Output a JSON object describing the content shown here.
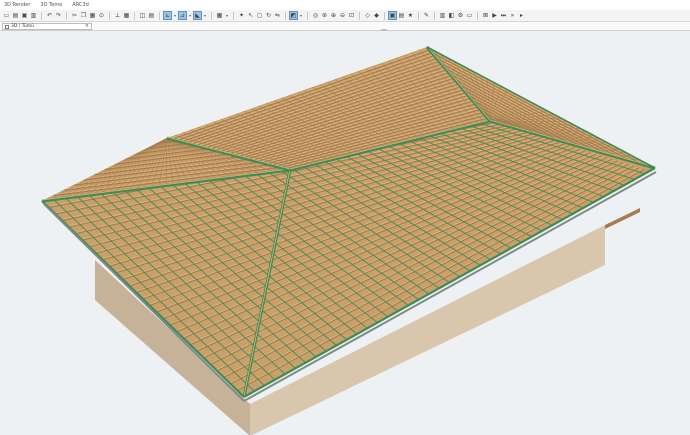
{
  "app": {
    "title_items": [
      "3D Render",
      "3D Teme",
      "ARC3d"
    ]
  },
  "toolbar": {
    "buttons": [
      {
        "name": "new-file-icon",
        "glyph": "▭"
      },
      {
        "name": "open-file-icon",
        "glyph": "▤"
      },
      {
        "name": "save-icon",
        "glyph": "▣"
      },
      {
        "name": "print-icon",
        "glyph": "▥"
      },
      {
        "name": "sep",
        "glyph": ""
      },
      {
        "name": "undo-icon",
        "glyph": "↶"
      },
      {
        "name": "redo-icon",
        "glyph": "↷"
      },
      {
        "name": "sep",
        "glyph": ""
      },
      {
        "name": "cut-icon",
        "glyph": "✂"
      },
      {
        "name": "copy-icon",
        "glyph": "❐"
      },
      {
        "name": "paste-icon",
        "glyph": "▦"
      },
      {
        "name": "pick-icon",
        "glyph": "⊙"
      },
      {
        "name": "sep",
        "glyph": ""
      },
      {
        "name": "measure-icon",
        "glyph": "⟂"
      },
      {
        "name": "grid-icon",
        "glyph": "▦"
      },
      {
        "name": "sep",
        "glyph": ""
      },
      {
        "name": "trace-icon",
        "glyph": "◫"
      },
      {
        "name": "layer-icon",
        "glyph": "▤"
      },
      {
        "name": "sep",
        "glyph": ""
      },
      {
        "name": "snap-icon",
        "glyph": "⊾",
        "active": true
      },
      {
        "name": "dropdown-icon",
        "glyph": "▾",
        "dd": true
      },
      {
        "name": "guide-icon",
        "glyph": "⊿",
        "active": true
      },
      {
        "name": "dropdown-icon",
        "glyph": "▾",
        "dd": true
      },
      {
        "name": "gravity-icon",
        "glyph": "◣",
        "active": true
      },
      {
        "name": "dropdown-icon",
        "glyph": "▾",
        "dd": true
      },
      {
        "name": "sep",
        "glyph": ""
      },
      {
        "name": "suspend-groups-icon",
        "glyph": "▦"
      },
      {
        "name": "dropdown-icon",
        "glyph": "▾",
        "dd": true
      },
      {
        "name": "sep",
        "glyph": ""
      },
      {
        "name": "magic-wand-icon",
        "glyph": "✦"
      },
      {
        "name": "pointer-icon",
        "glyph": "↖"
      },
      {
        "name": "marquee-icon",
        "glyph": "◻"
      },
      {
        "name": "rotate-icon",
        "glyph": "↻"
      },
      {
        "name": "mirror-icon",
        "glyph": "⇋"
      },
      {
        "name": "sep",
        "glyph": ""
      },
      {
        "name": "3d-window-icon",
        "glyph": "◩",
        "active": true
      },
      {
        "name": "dropdown-icon",
        "glyph": "▾",
        "dd": true
      },
      {
        "name": "sep",
        "glyph": ""
      },
      {
        "name": "explore-icon",
        "glyph": "◎"
      },
      {
        "name": "orbit-icon",
        "glyph": "⊛"
      },
      {
        "name": "zoom-in-icon",
        "glyph": "⊕"
      },
      {
        "name": "zoom-out-icon",
        "glyph": "⊖"
      },
      {
        "name": "fit-icon",
        "glyph": "⊡"
      },
      {
        "name": "sep",
        "glyph": ""
      },
      {
        "name": "wireframe-icon",
        "glyph": "◇"
      },
      {
        "name": "shading-icon",
        "glyph": "◆"
      },
      {
        "name": "sep",
        "glyph": ""
      },
      {
        "name": "view-3d-icon",
        "glyph": "▣",
        "active": true
      },
      {
        "name": "view-section-icon",
        "glyph": "▤"
      },
      {
        "name": "favorites-icon",
        "glyph": "★"
      },
      {
        "name": "sep",
        "glyph": ""
      },
      {
        "name": "marker-icon",
        "glyph": "✎"
      },
      {
        "name": "sep",
        "glyph": ""
      },
      {
        "name": "filter-icon",
        "glyph": "▥"
      },
      {
        "name": "palette-icon",
        "glyph": "◧"
      },
      {
        "name": "settings-icon",
        "glyph": "⚙"
      },
      {
        "name": "window-icon",
        "glyph": "▭"
      },
      {
        "name": "sep",
        "glyph": ""
      },
      {
        "name": "collapse-icon",
        "glyph": "⊠"
      },
      {
        "name": "play-icon",
        "glyph": "▶"
      },
      {
        "name": "skip-icon",
        "glyph": "⏭"
      },
      {
        "name": "forward-icon",
        "glyph": "»"
      },
      {
        "name": "more-icon",
        "glyph": "▸"
      }
    ]
  },
  "view_tab": {
    "icon": "3d-view-icon",
    "label": "3D / Tümü",
    "close": "×"
  },
  "colors": {
    "tile_base": "#c9a06a",
    "tile_light": "#dcb684",
    "tile_shadow": "#a47c4d",
    "ridge_green": "#3f8b55",
    "wall_left": "#c6b299",
    "wall_front": "#d8c6ad",
    "wall_right": "#d5c3aa",
    "fascia": "#7e8c86"
  }
}
